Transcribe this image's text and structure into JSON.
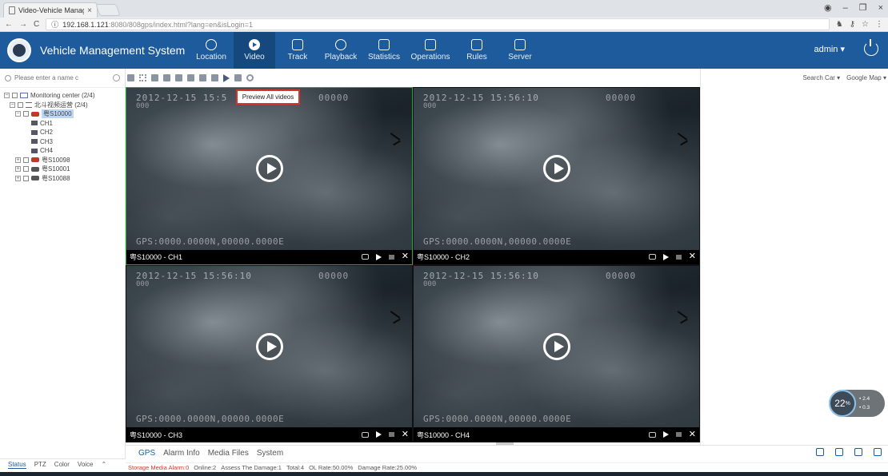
{
  "browser": {
    "tab_title": "Video-Vehicle Manage",
    "tab_close": "×",
    "url_host": "192.168.1.121",
    "url_rest": ":8080/808gps/index.html?lang=en&isLogin=1",
    "win_controls": [
      "–",
      "❐",
      "×"
    ]
  },
  "app": {
    "title": "Vehicle Management System",
    "user": "admin ▾",
    "nav": [
      {
        "label": "Location",
        "icon": "location-icon"
      },
      {
        "label": "Video",
        "icon": "video-icon",
        "active": true
      },
      {
        "label": "Track",
        "icon": "track-icon"
      },
      {
        "label": "Playback",
        "icon": "playback-icon"
      },
      {
        "label": "Statistics",
        "icon": "statistics-icon"
      },
      {
        "label": "Operations",
        "icon": "operations-icon"
      },
      {
        "label": "Rules",
        "icon": "rules-icon"
      },
      {
        "label": "Server",
        "icon": "server-icon"
      }
    ]
  },
  "sidebar": {
    "search_placeholder": "Please enter a name c",
    "tree": {
      "root": "Monitoring center (2/4)",
      "group": "北斗视频运营 (2/4)",
      "vehicle_selected": "粤S10000",
      "channels": [
        "CH1",
        "CH2",
        "CH3",
        "CH4"
      ],
      "vehicles": [
        "粤S10098",
        "粤S10001",
        "粤S10088"
      ]
    },
    "bottom_tabs": [
      "Status",
      "PTZ",
      "Color",
      "Voice"
    ]
  },
  "tooltip": "Preview All videos",
  "videos": [
    {
      "name": "粤S10000 - CH1",
      "osd_time": "2012-12-15 15:5",
      "osd_id": "00000",
      "osd_sub": "000",
      "gps": "GPS:0000.0000N,00000.0000E"
    },
    {
      "name": "粤S10000 - CH2",
      "osd_time": "2012-12-15 15:56:10",
      "osd_id": "00000",
      "osd_sub": "000",
      "gps": "GPS:0000.0000N,00000.0000E"
    },
    {
      "name": "粤S10000 - CH3",
      "osd_time": "2012-12-15 15:56:10",
      "osd_id": "00000",
      "osd_sub": "000",
      "gps": "GPS:0000.0000N,00000.0000E"
    },
    {
      "name": "粤S10000 - CH4",
      "osd_time": "2012-12-15 15:56:10",
      "osd_id": "00000",
      "osd_sub": "000",
      "gps": "GPS:0000.0000N,00000.0000E"
    }
  ],
  "bottom": {
    "tabs": [
      "GPS",
      "Alarm Info",
      "Media Files",
      "System"
    ],
    "status": {
      "alarm": "Storage Media Alarm:0",
      "online": "Online:2",
      "damage": "Assess The Damage:1",
      "total": "Total:4",
      "ol_rate": "OL Rate:50.00%",
      "damage_rate": "Damage Rate:25.00%"
    }
  },
  "map": {
    "search_car": "Search Car ▾",
    "provider": "Google Map ▾"
  },
  "speed_widget": {
    "percent": "22",
    "percent_unit": "%",
    "up": "2.4",
    "down": "0.3"
  },
  "colors": {
    "header_bg": "#1d5b9c",
    "active_cell_border": "#27a844",
    "tooltip_border": "#d9342b"
  }
}
